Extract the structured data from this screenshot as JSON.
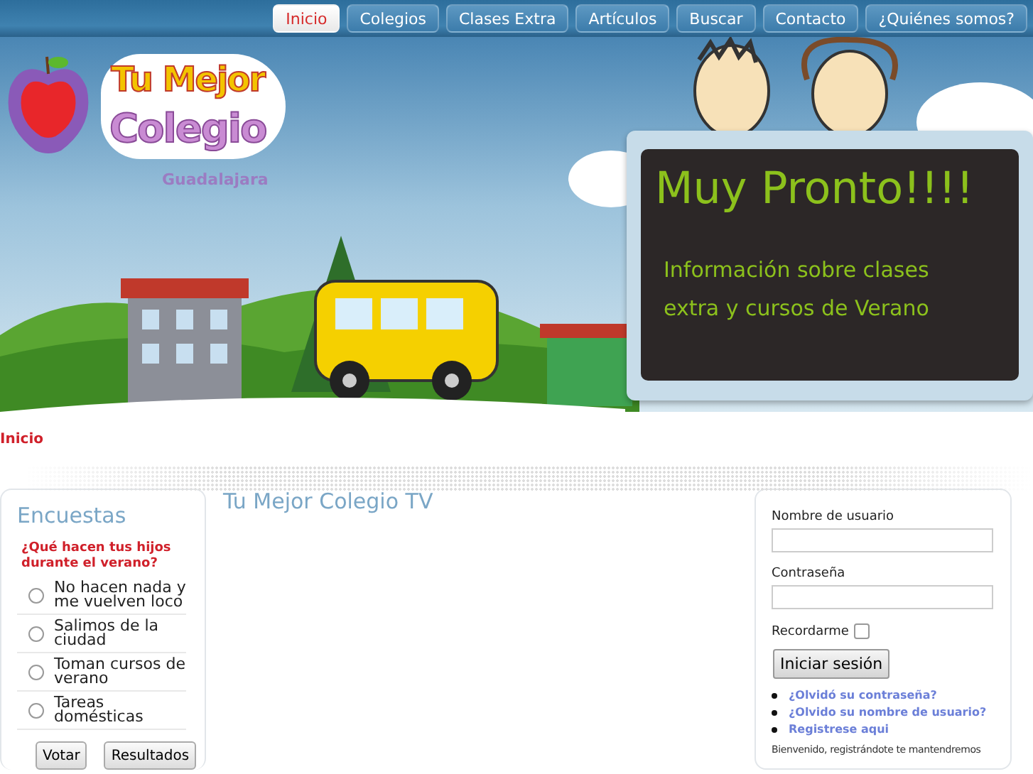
{
  "nav": [
    {
      "label": "Inicio",
      "selected": true
    },
    {
      "label": "Colegios",
      "selected": false
    },
    {
      "label": "Clases Extra",
      "selected": false
    },
    {
      "label": "Artículos",
      "selected": false
    },
    {
      "label": "Buscar",
      "selected": false
    },
    {
      "label": "Contacto",
      "selected": false
    },
    {
      "label": "¿Quiénes somos?",
      "selected": false
    }
  ],
  "header": {
    "logo": {
      "line_1": "Tu Mejor",
      "line_2": "Colegio",
      "tagline": "Guadalajara"
    },
    "sign": {
      "title": "Muy Pronto!!!!",
      "text": "Información sobre clases extra y cursos de Verano"
    }
  },
  "breadcrumb": "Inicio",
  "poll": {
    "title": "Encuestas",
    "question": "¿Qué hacen tus hijos durante el verano?",
    "options": [
      {
        "label": "No hacen nada y me vuelven loco",
        "selected": false
      },
      {
        "label": "Salimos de la ciudad",
        "selected": false
      },
      {
        "label": "Toman cursos de verano",
        "selected": false
      },
      {
        "label": "Tareas domésticas",
        "selected": false
      }
    ],
    "buttons": [
      "Votar",
      "Resultados"
    ]
  },
  "main": {
    "title": "Tu Mejor Colegio TV"
  },
  "login": {
    "username_label": "Nombre de usuario",
    "password_label": "Contraseña",
    "remember": {
      "label": "Recordarme",
      "checked": false
    },
    "submit": "Iniciar sesión",
    "links": [
      "¿Olvidó su contraseña?",
      "¿Olvido su nombre de usuario?",
      "Registrese aqui"
    ],
    "note": "Bienvenido, registrándote te mantendremos"
  }
}
